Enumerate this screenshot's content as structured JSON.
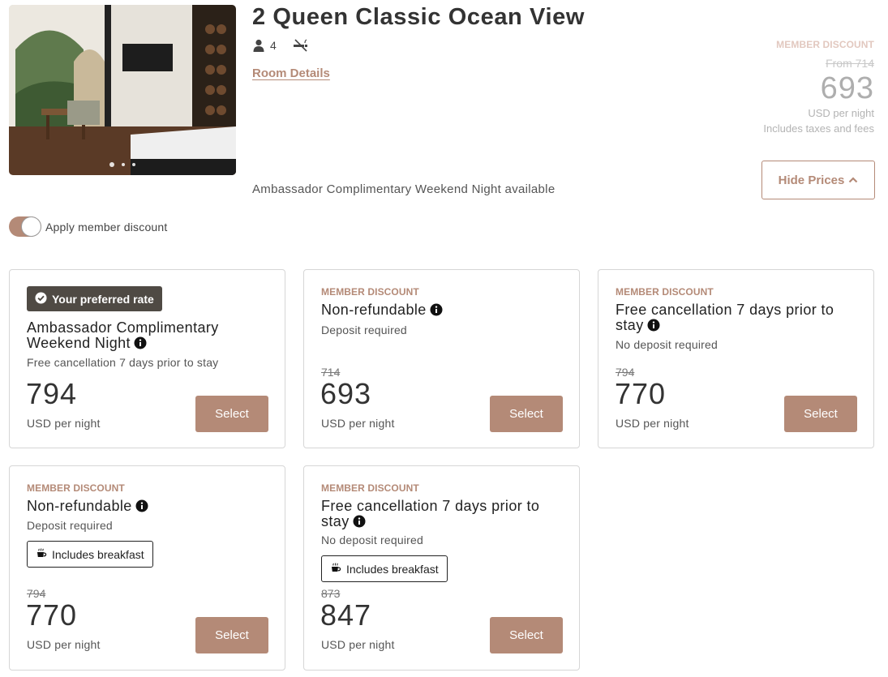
{
  "room": {
    "title": "2 Queen Classic Ocean View",
    "guests": "4",
    "details_link": "Room Details",
    "weekend_note": "Ambassador Complimentary Weekend Night available",
    "icons": {
      "guests": "person-icon",
      "smoking": "no-smoking-icon"
    }
  },
  "summary": {
    "badge": "MEMBER DISCOUNT",
    "was": "From 714",
    "price": "693",
    "unit": "USD per night",
    "taxes": "Includes taxes and fees"
  },
  "hide_prices": "Hide Prices",
  "member_toggle": {
    "label": "Apply member discount",
    "on": true
  },
  "rates": [
    {
      "preferred_label": "Your preferred rate",
      "name": "Ambassador Complimentary Weekend Night",
      "condition": "Free cancellation 7 days prior to stay",
      "price": "794",
      "unit": "USD per night",
      "select": "Select"
    },
    {
      "badge": "MEMBER DISCOUNT",
      "name": "Non-refundable",
      "condition": "Deposit required",
      "old_price": "714",
      "price": "693",
      "unit": "USD per night",
      "select": "Select"
    },
    {
      "badge": "MEMBER DISCOUNT",
      "name": "Free cancellation 7 days prior to stay",
      "condition": "No deposit required",
      "old_price": "794",
      "price": "770",
      "unit": "USD per night",
      "select": "Select"
    },
    {
      "badge": "MEMBER DISCOUNT",
      "name": "Non-refundable",
      "condition": "Deposit required",
      "breakfast": "Includes breakfast",
      "old_price": "794",
      "price": "770",
      "unit": "USD per night",
      "select": "Select"
    },
    {
      "badge": "MEMBER DISCOUNT",
      "name": "Free cancellation 7 days prior to stay",
      "condition": "No deposit required",
      "breakfast": "Includes breakfast",
      "old_price": "873",
      "price": "847",
      "unit": "USD per night",
      "select": "Select"
    }
  ],
  "colors": {
    "accent": "#b48a77",
    "preferred_badge": "#4f4a44",
    "card_border": "#d6d6d6"
  }
}
